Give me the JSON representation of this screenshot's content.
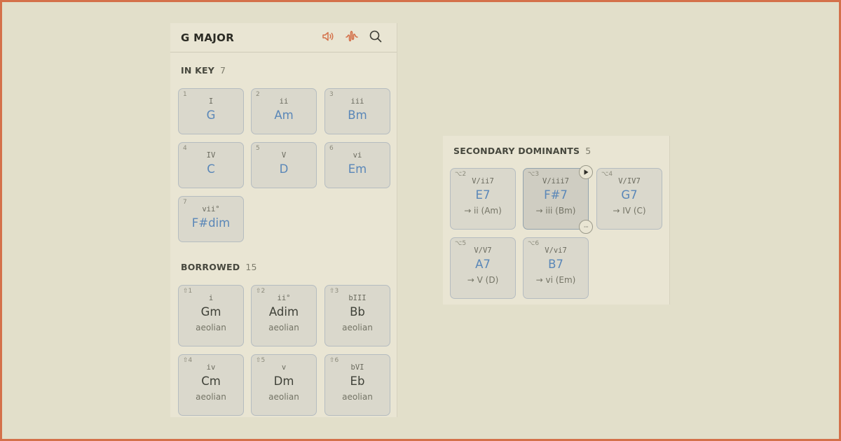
{
  "header": {
    "title": "G MAJOR",
    "icons": [
      "speaker-icon",
      "waveform-icon",
      "search-icon"
    ],
    "accent": "#d4714a"
  },
  "in_key": {
    "label": "IN KEY",
    "count": "7",
    "chords": [
      {
        "deg": "1",
        "roman": "I",
        "name": "G"
      },
      {
        "deg": "2",
        "roman": "ii",
        "name": "Am"
      },
      {
        "deg": "3",
        "roman": "iii",
        "name": "Bm"
      },
      {
        "deg": "4",
        "roman": "IV",
        "name": "C"
      },
      {
        "deg": "5",
        "roman": "V",
        "name": "D"
      },
      {
        "deg": "6",
        "roman": "vi",
        "name": "Em"
      },
      {
        "deg": "7",
        "roman": "vii°",
        "name": "F#dim"
      }
    ]
  },
  "borrowed": {
    "label": "BORROWED",
    "count": "15",
    "chords": [
      {
        "deg": "⇧1",
        "roman": "i",
        "name": "Gm",
        "sub": "aeolian"
      },
      {
        "deg": "⇧2",
        "roman": "ii°",
        "name": "Adim",
        "sub": "aeolian"
      },
      {
        "deg": "⇧3",
        "roman": "bIII",
        "name": "Bb",
        "sub": "aeolian"
      },
      {
        "deg": "⇧4",
        "roman": "iv",
        "name": "Cm",
        "sub": "aeolian"
      },
      {
        "deg": "⇧5",
        "roman": "v",
        "name": "Dm",
        "sub": "aeolian"
      },
      {
        "deg": "⇧6",
        "roman": "bVI",
        "name": "Eb",
        "sub": "aeolian"
      }
    ]
  },
  "secondary": {
    "label": "SECONDARY DOMINANTS",
    "count": "5",
    "chords": [
      {
        "deg": "⌥2",
        "roman": "V/ii7",
        "name": "E7",
        "sub": "→ ii (Am)"
      },
      {
        "deg": "⌥3",
        "roman": "V/iii7",
        "name": "F#7",
        "sub": "→ iii (Bm)"
      },
      {
        "deg": "⌥4",
        "roman": "V/IV7",
        "name": "G7",
        "sub": "→ IV (C)"
      },
      {
        "deg": "⌥5",
        "roman": "V/V7",
        "name": "A7",
        "sub": "→ V (D)"
      },
      {
        "deg": "⌥6",
        "roman": "V/vi7",
        "name": "B7",
        "sub": "→ vi (Em)"
      }
    ],
    "play_icon": "play-icon",
    "more_icon": "more-icon",
    "more_label": "···"
  }
}
